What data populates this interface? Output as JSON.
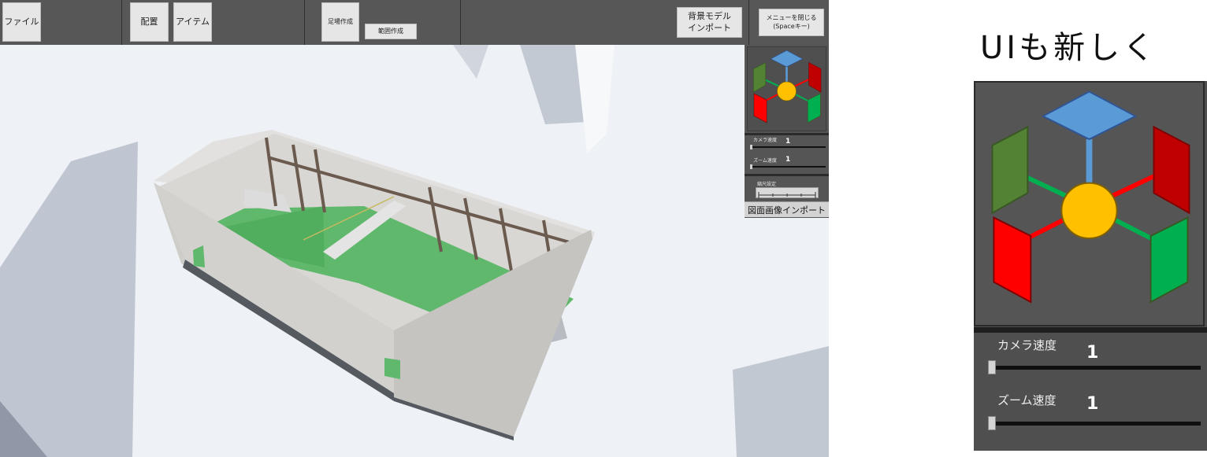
{
  "toolbar": {
    "file": "ファイル",
    "place": "配置",
    "item": "アイテム",
    "scaffold_create": "足場作成",
    "range_create": "範囲作成",
    "bg_model_line1": "背景モデル",
    "bg_model_line2": "インポート",
    "close_menu_line1": "メニューを閉じる",
    "close_menu_line2": "(Spaceキー)"
  },
  "side_panel": {
    "camera_speed_label": "カメラ速度",
    "camera_speed_value": "1",
    "zoom_speed_label": "ズーム速度",
    "zoom_speed_value": "1",
    "scale_label": "縮尺設定",
    "drawing_import": "図面画像インポート"
  },
  "zoom_panel": {
    "caption": "UIも新しく",
    "camera_speed_label": "カメラ速度",
    "camera_speed_value": "1",
    "zoom_speed_label": "ズーム速度",
    "zoom_speed_value": "1"
  },
  "gizmo_colors": {
    "top": "#5b9bd5",
    "left_back": "#548235",
    "right_back": "#c00000",
    "left_front": "#ff0000",
    "right_front": "#00b050",
    "center": "#ffc000",
    "axis_green": "#00b050",
    "axis_red": "#ff0000"
  },
  "camera_speed_level": 0,
  "zoom_speed_level": 0
}
